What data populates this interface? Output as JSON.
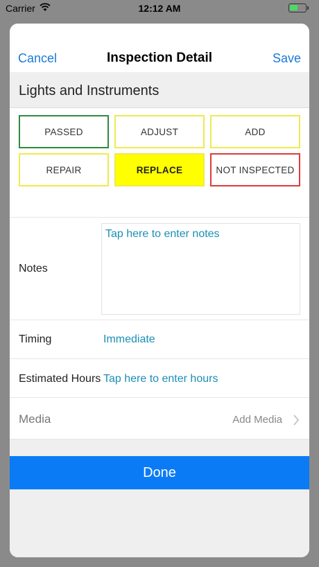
{
  "status_bar": {
    "carrier": "Carrier",
    "time": "12:12 AM",
    "battery_level": 0.5,
    "battery_color": "#4cd964"
  },
  "nav": {
    "cancel_label": "Cancel",
    "title": "Inspection Detail",
    "save_label": "Save"
  },
  "section": {
    "title": "Lights and Instruments"
  },
  "status_options": {
    "passed": "PASSED",
    "adjust": "ADJUST",
    "add": "ADD",
    "repair": "REPAIR",
    "replace": "REPLACE",
    "not_inspected": "NOT INSPECTED",
    "selected": "REPLACE"
  },
  "notes": {
    "label": "Notes",
    "placeholder": "Tap here to enter notes"
  },
  "timing": {
    "label": "Timing",
    "value": "Immediate"
  },
  "hours": {
    "label": "Estimated Hours",
    "placeholder": "Tap here to enter hours"
  },
  "media": {
    "label": "Media",
    "action": "Add Media"
  },
  "done_label": "Done",
  "colors": {
    "accent": "#1a7ad6",
    "done_button": "#0a7bf5",
    "passed_border": "#2e8b3d",
    "warning_border": "#f0ea4c",
    "selected_fill": "#ffff00",
    "not_inspected_border": "#e03a3a",
    "link_text": "#1a8fb5"
  }
}
